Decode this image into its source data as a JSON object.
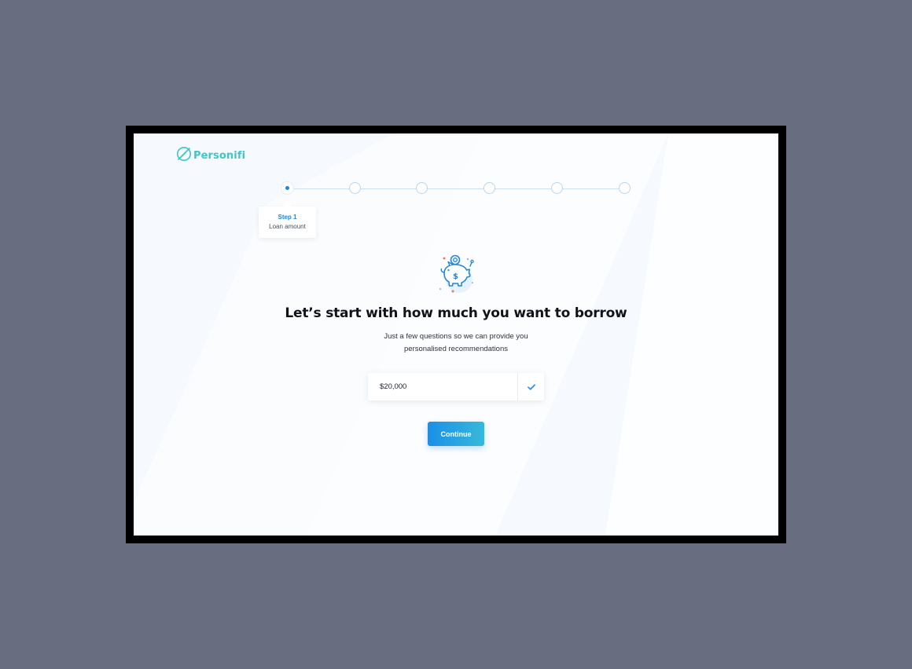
{
  "brand": {
    "name": "Personifi",
    "color": "#3ec6c7"
  },
  "stepper": {
    "total_steps": 6,
    "current_step": 1,
    "active_color": "#1b88e3",
    "tooltip": {
      "title": "Step 1",
      "subtitle": "Loan amount"
    }
  },
  "main": {
    "illustration": "piggy-bank-icon",
    "heading": "Let’s start with how much you want to borrow",
    "subtext_line1": "Just a few questions so we can provide you",
    "subtext_line2": "personalised recommendations"
  },
  "amount": {
    "value": "$20,000",
    "confirm_icon": "check-icon"
  },
  "continue_button": {
    "label": "Continue",
    "gradient_start": "#1a8fe6",
    "gradient_end": "#37b9db"
  }
}
